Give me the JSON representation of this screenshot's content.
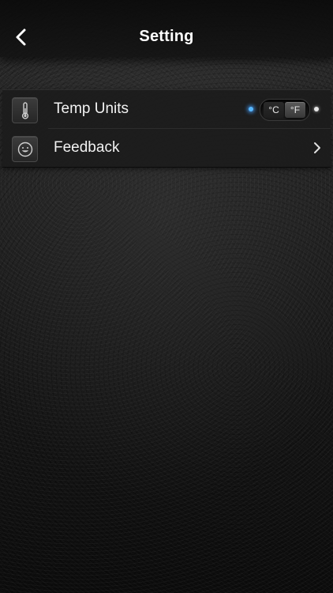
{
  "header": {
    "title": "Setting",
    "back_icon": "chevron-left-icon"
  },
  "settings": {
    "items": [
      {
        "icon": "thermometer-icon",
        "label": "Temp Units",
        "control": "unit-toggle",
        "options": [
          "°C",
          "°F"
        ],
        "selected": "°F"
      },
      {
        "icon": "smiley-face-icon",
        "label": "Feedback",
        "control": "chevron-right-icon"
      }
    ]
  },
  "colors": {
    "led_active": "#58b8ff",
    "led_inactive": "#e6e6e6",
    "text_primary": "#ffffff"
  }
}
